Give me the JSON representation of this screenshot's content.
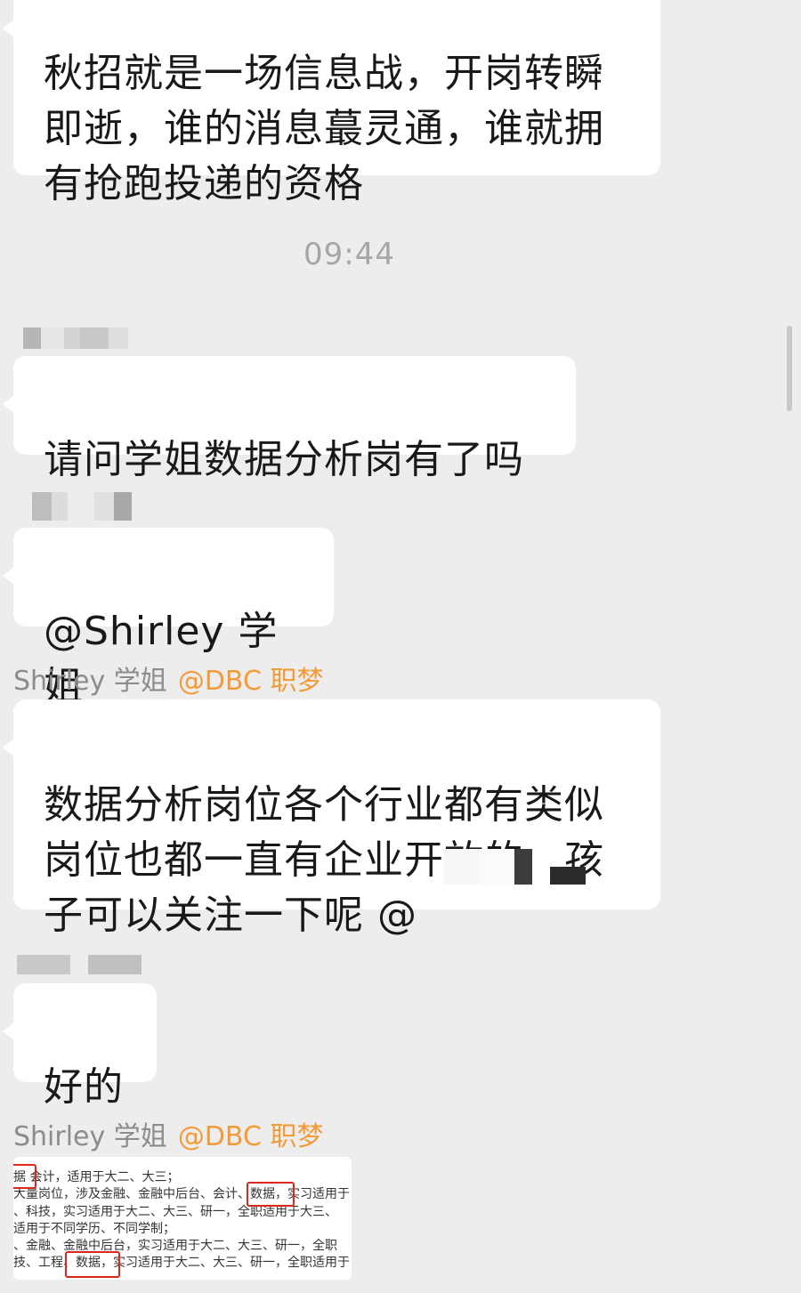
{
  "messages": {
    "m1": "秋招就是一场信息战，开岗转瞬\n即逝，谁的消息蕞灵通，谁就拥\n有抢跑投递的资格",
    "time": "09:44",
    "m2": "请问学姐数据分析岗有了吗",
    "m3": "@Shirley 学姐",
    "m4_sender": "Shirley 学姐",
    "m4_mention": "@DBC 职梦",
    "m4": "数据分析岗位各个行业都有类似\n岗位也都一直有企业开放的，孩\n子可以关注一下呢 @",
    "m5": "好的",
    "m6_sender": "Shirley 学姐",
    "m6_mention": "@DBC 职梦"
  },
  "image": {
    "lines": [
      "据  会计，适用于大二、大三；",
      "大量岗位，涉及金融、金融中后台、会计、数据，实习适用于",
      "、科技，实习适用于大二、大三、研一，全职适用于大三、",
      "适用于不同学历、不同学制；",
      "、金融、金融中后台，实习适用于大二、大三、研一，全职",
      "技、工程、数据，实习适用于大二、大三、研一，全职适用于"
    ]
  },
  "colors": {
    "background": "#ededed",
    "bubble": "#ffffff",
    "mention": "#f29b38",
    "highlight_box": "#d8281f"
  }
}
